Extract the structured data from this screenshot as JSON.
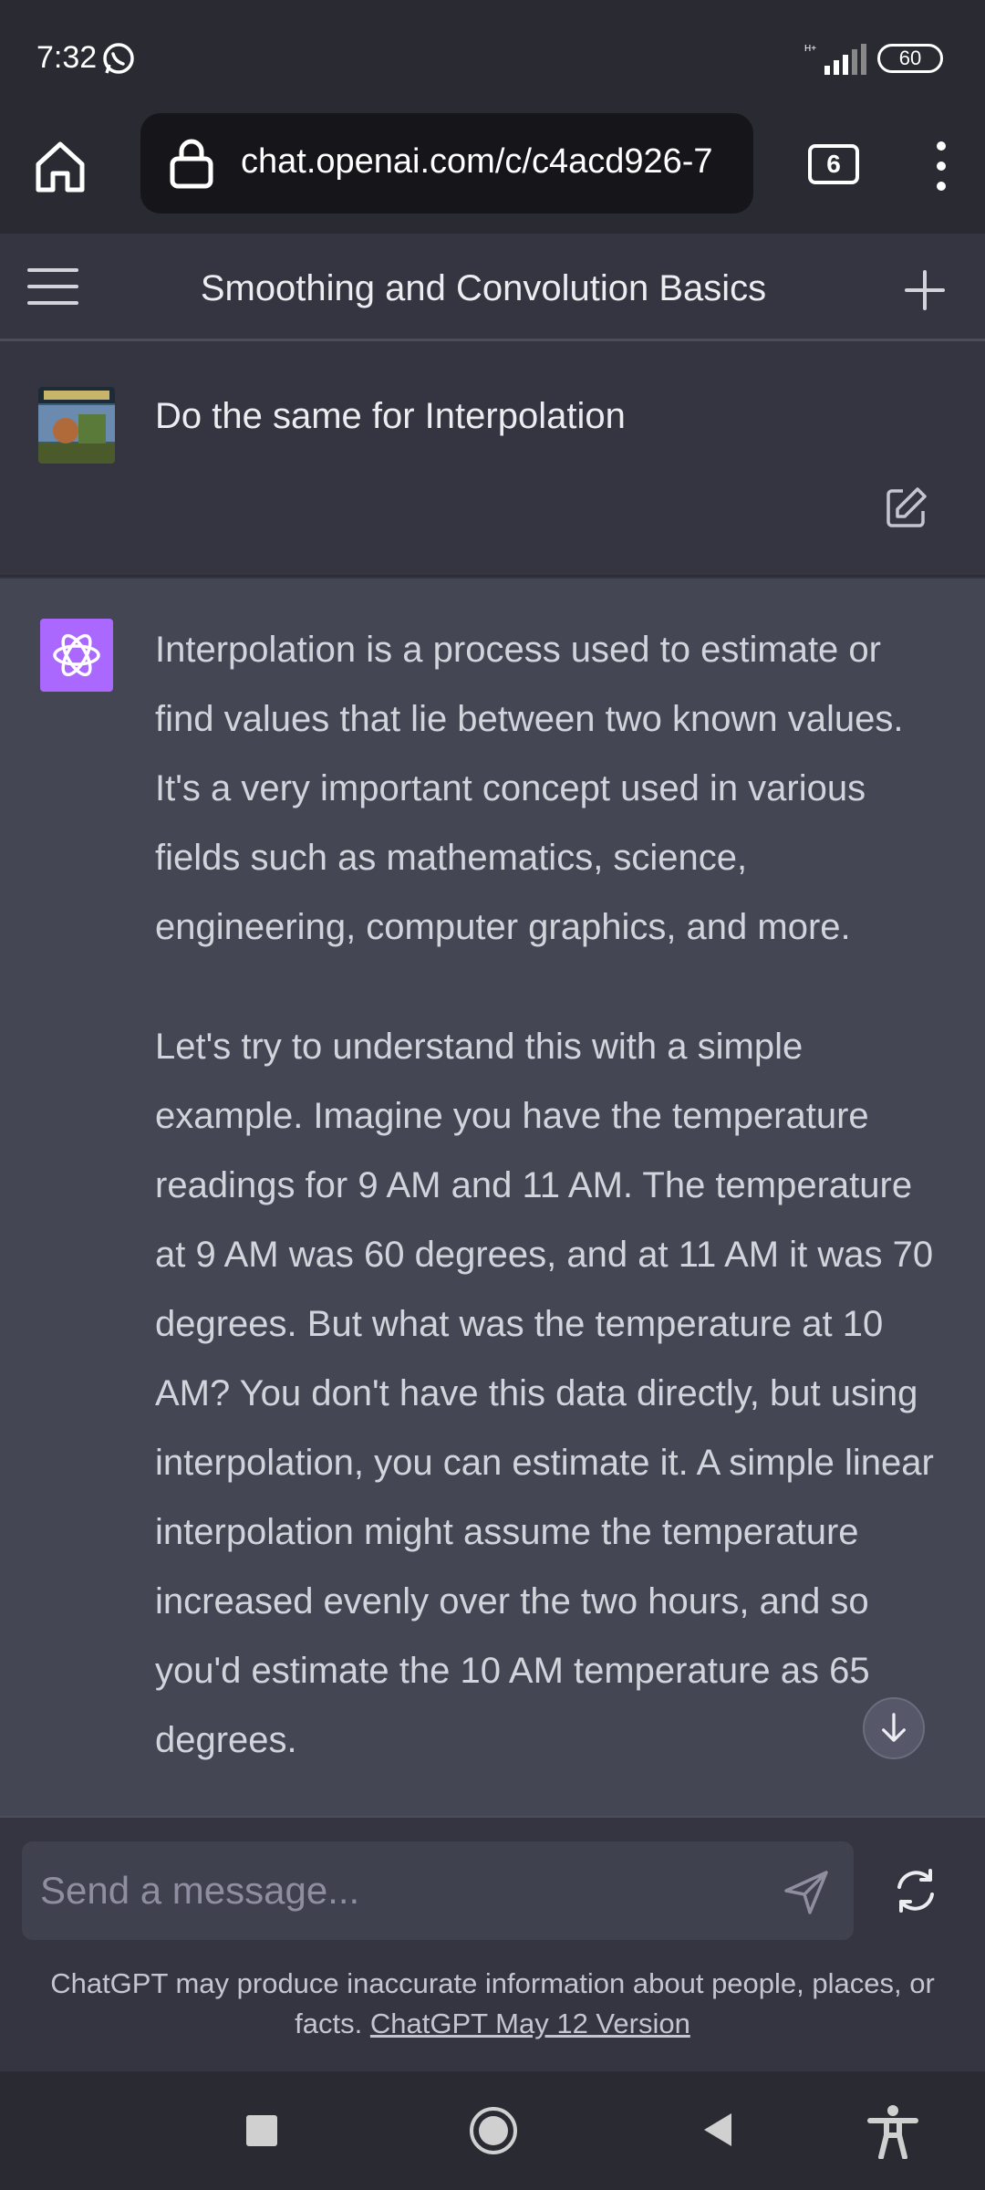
{
  "status_bar": {
    "time": "7:32",
    "network": "H+",
    "battery": "60"
  },
  "browser": {
    "url": "chat.openai.com/c/c4acd926-7",
    "tab_count": "6"
  },
  "chat": {
    "title": "Smoothing and Convolution Basics",
    "user_message": "Do the same for Interpolation",
    "assistant_paragraphs": [
      "Interpolation is a process used to estimate or find values that lie between two known values. It's a very important concept used in various fields such as mathematics, science, engineering, computer graphics, and more.",
      "Let's try to understand this with a simple example. Imagine you have the temperature readings for 9 AM and 11 AM. The temperature at 9 AM was 60 degrees, and at 11 AM it was 70 degrees. But what was the temperature at 10 AM? You don't have this data directly, but using interpolation, you can estimate it. A simple linear interpolation might assume the temperature increased evenly over the two hours, and so you'd estimate the 10 AM temperature as 65 degrees."
    ]
  },
  "composer": {
    "placeholder": "Send a message...",
    "disclaimer": "ChatGPT may produce inaccurate information about people, places, or facts.",
    "version_link": "ChatGPT May 12 Version"
  },
  "colors": {
    "accent_avatar": "#ab68ff",
    "chat_background": "#343541",
    "assistant_background": "#444654"
  },
  "icons": [
    "whatsapp-icon",
    "signal-icon",
    "home-icon",
    "lock-icon",
    "tabs-icon",
    "more-vert-icon",
    "hamburger-icon",
    "plus-icon",
    "edit-icon",
    "openai-logo-icon",
    "arrow-down-icon",
    "send-icon",
    "regenerate-icon",
    "recents-icon",
    "home-circle-icon",
    "back-icon",
    "accessibility-icon"
  ]
}
